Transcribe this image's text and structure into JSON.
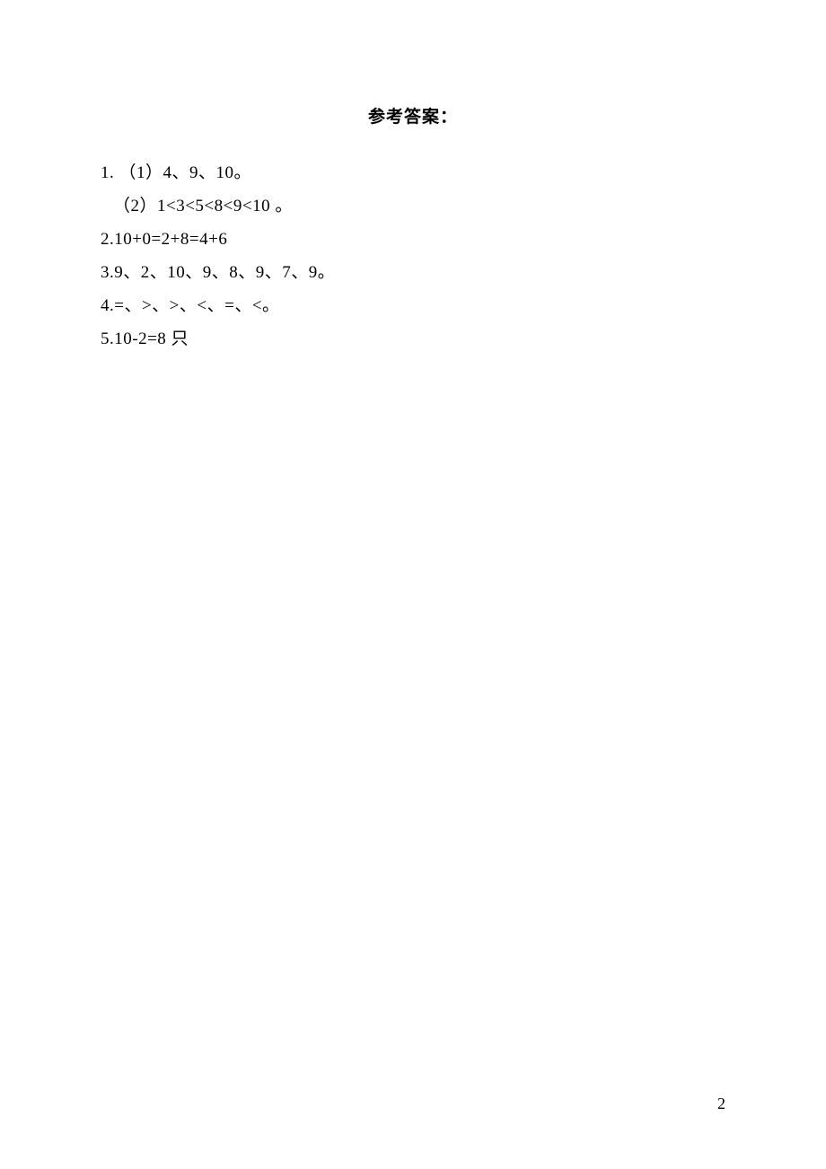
{
  "title": "参考答案：",
  "answers": {
    "line1": "1. （1）4、9、10。",
    "line2": "（2）1<3<5<8<9<10 。",
    "line3": "2.10+0=2+8=4+6",
    "line4": "3.9、2、10、9、8、9、7、9。",
    "line5": "4.=、>、>、<、=、<。",
    "line6": "5.10-2=8 只"
  },
  "page_number": "2"
}
